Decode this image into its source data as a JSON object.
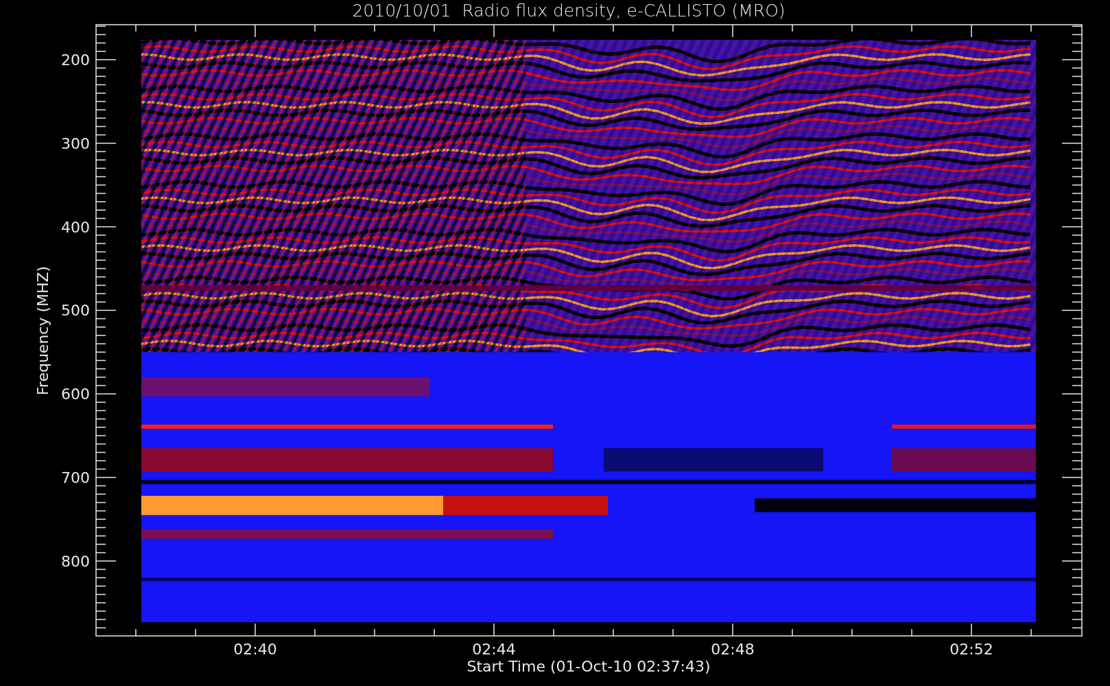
{
  "title": "2010/10/01  Radio flux density, e-CALLISTO (MRO)",
  "y_axis": {
    "label": "Frequency (MHZ)",
    "ticks": [
      "200",
      "300",
      "400",
      "500",
      "600",
      "700",
      "800"
    ]
  },
  "x_axis": {
    "label": "Start Time (01-Oct-10 02:37:43)",
    "ticks": [
      "02:40",
      "02:44",
      "02:48",
      "02:52"
    ]
  }
}
